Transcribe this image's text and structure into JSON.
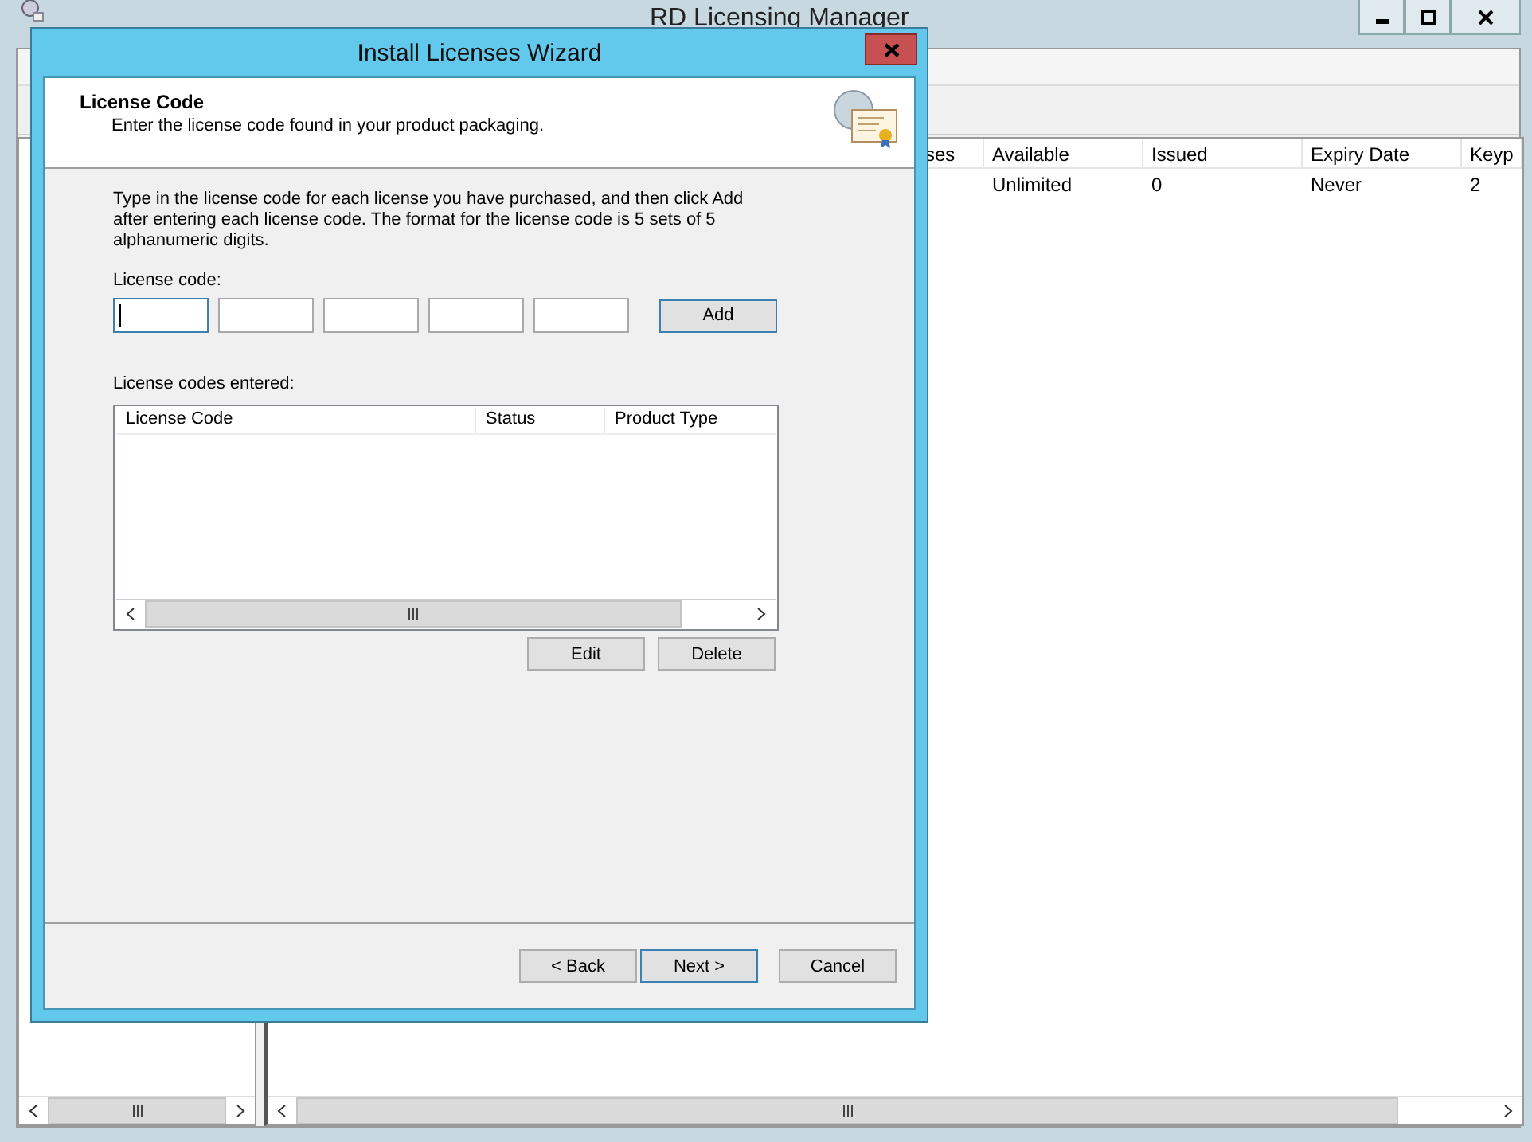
{
  "background_window": {
    "title": "RD Licensing Manager",
    "list": {
      "columns": [
        "ses",
        "Available",
        "Issued",
        "Expiry Date",
        "Keyp"
      ],
      "rows": [
        {
          "cells": [
            "",
            "Unlimited",
            "0",
            "Never",
            "2"
          ]
        }
      ]
    }
  },
  "dialog": {
    "title": "Install Licenses Wizard",
    "header": {
      "title": "License Code",
      "subtitle": "Enter the license code found in your product packaging."
    },
    "instructions": "Type in the license code for each license you have purchased, and then click Add after entering each license code. The format for the license code is 5 sets of 5 alphanumeric digits.",
    "code_label": "License code:",
    "code_fields": [
      {
        "focused": true
      },
      {
        "focused": false
      },
      {
        "focused": false
      },
      {
        "focused": false
      },
      {
        "focused": false
      }
    ],
    "add_button": {
      "label": "Add",
      "default": true
    },
    "entered_label": "License codes entered:",
    "table": {
      "columns": [
        "License Code",
        "Status",
        "Product Type"
      ]
    },
    "table_buttons": [
      {
        "label": "Edit",
        "default": false
      },
      {
        "label": "Delete",
        "default": false
      }
    ],
    "nav_buttons": [
      {
        "label": "< Back",
        "default": false
      },
      {
        "label": "Next >",
        "default": true
      },
      {
        "label": "Cancel",
        "default": false
      }
    ]
  }
}
